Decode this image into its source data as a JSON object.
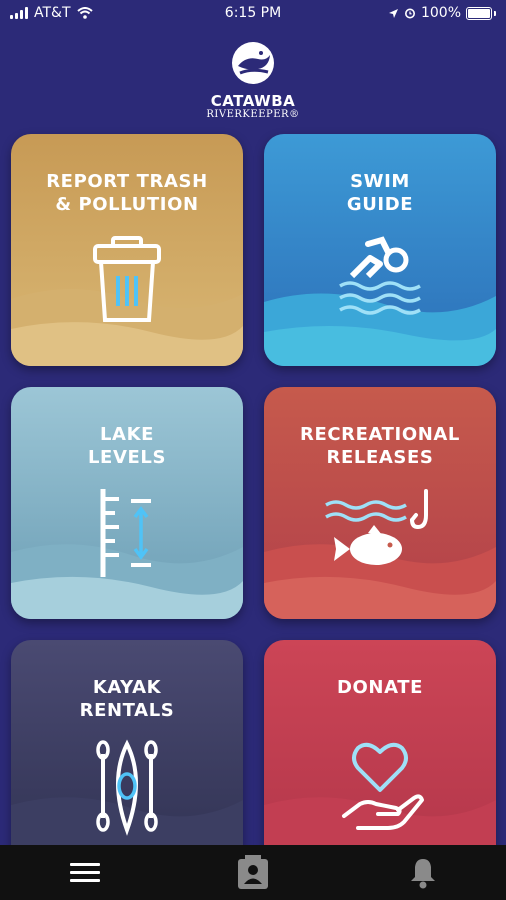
{
  "status_bar": {
    "carrier": "AT&T",
    "time": "6:15 PM",
    "battery": "100%"
  },
  "logo": {
    "name": "CATAWBA",
    "sub": "RIVERKEEPER®"
  },
  "tiles": [
    {
      "label": "REPORT TRASH\n& POLLUTION",
      "icon": "trash-can-icon"
    },
    {
      "label": "SWIM\nGUIDE",
      "icon": "swimmer-icon"
    },
    {
      "label": "LAKE\nLEVELS",
      "icon": "water-level-gauge-icon"
    },
    {
      "label": "RECREATIONAL\nRELEASES",
      "icon": "fish-hook-icon"
    },
    {
      "label": "KAYAK\nRENTALS",
      "icon": "kayak-icon"
    },
    {
      "label": "DONATE",
      "icon": "heart-hand-icon"
    }
  ],
  "bottom_nav": [
    "menu-icon",
    "profile-badge-icon",
    "bell-icon"
  ],
  "colors": {
    "background": "#2c2a78",
    "trash": "#c8a25a",
    "swim": "#3a8fd0",
    "lake": "#8ab6c6",
    "recreation": "#c8504a",
    "kayak": "#3a3b5f",
    "donate": "#c83e4c",
    "accent_blue": "#4fc3f7"
  }
}
